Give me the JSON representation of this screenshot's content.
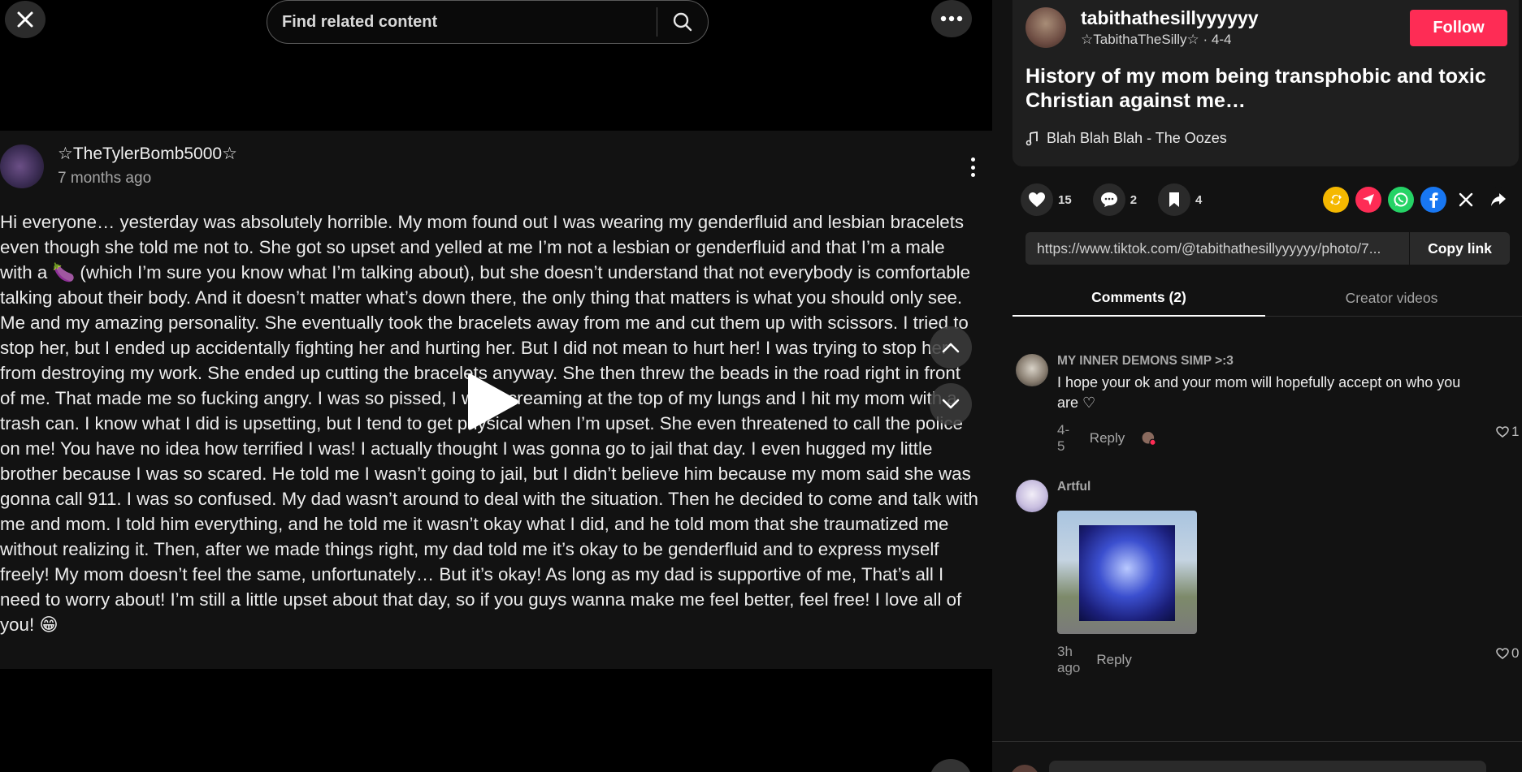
{
  "search": {
    "placeholder": "Find related content"
  },
  "post": {
    "author": "☆TheTylerBomb5000☆",
    "time": "7 months ago",
    "body": "Hi everyone… yesterday was absolutely horrible. My mom found out I was wearing my genderfluid and lesbian bracelets even though she told me not to. She got so upset and yelled at me I’m not a lesbian or genderfluid and that I’m a male with a 🍆 (which I’m sure you know what I’m talking about), but she doesn’t understand that not everybody is comfortable talking about their body. And it doesn’t matter what’s down there, the only thing that matters is what you should only see. Me and my amazing personality. She eventually took the bracelets away from me and cut them up with scissors. I tried to stop her, but I ended up accidentally fighting her and hurting her. But I did not mean to hurt her! I was trying to stop her from destroying my work. She ended up cutting the bracelets anyway. She then threw the beads in the road right in front of me. That made me so fucking angry. I was so pissed, I was screaming at the top of my lungs and I hit my mom with a trash can. I know what I did is upsetting, but I tend to get physical when I’m upset. She even threatened to call the police on me! You have no idea how terrified I was! I actually thought I was gonna go to jail that day. I even hugged my little brother because I was so scared. He told me I wasn’t going to jail, but I didn’t believe him because my mom said she was gonna call 911. I was so confused. My dad wasn’t around to deal with the situation. Then he decided to come and talk with me and mom. I told him everything, and he told me it wasn’t okay what I did, and he told mom that she traumatized me without realizing it. Then, after we made things right, my dad told me it’s okay to be genderfluid and to express myself freely! My mom doesn’t feel the same, unfortunately… But it’s okay! As long as my dad is supportive of me, That’s all I need to worry about! I’m still a little upset about that day, so if you guys wanna make me feel better, feel free! I love all of you! 😁"
  },
  "creator": {
    "username": "tabithathesillyyyyyy",
    "nickname_date": "☆TabithaTheSilly☆ · 4-4",
    "follow_label": "Follow"
  },
  "title": "History of my mom being transphobic and toxic Christian against me…",
  "music": "Blah Blah Blah - The Oozes",
  "stats": {
    "likes": "15",
    "comments": "2",
    "saves": "4"
  },
  "share_icons": [
    {
      "name": "repost-icon",
      "color": "#f5b800"
    },
    {
      "name": "send-icon",
      "color": "#fe2c55"
    },
    {
      "name": "whatsapp-icon",
      "color": "#25d366"
    },
    {
      "name": "facebook-icon",
      "color": "#1877f2"
    },
    {
      "name": "x-icon",
      "color": "#000000"
    },
    {
      "name": "share-arrow-icon",
      "color": "#ffffff"
    }
  ],
  "link": {
    "url": "https://www.tiktok.com/@tabithathesillyyyyyy/photo/7...",
    "copy_label": "Copy link"
  },
  "tabs": [
    {
      "label": "Comments (2)",
      "active": true
    },
    {
      "label": "Creator videos",
      "active": false
    }
  ],
  "comments": [
    {
      "user": "MY INNER DEMONS SIMP >:3",
      "text": "I hope your ok and your mom will hopefully accept on who you are ♡",
      "date": "4-5",
      "reply_label": "Reply",
      "likes": "1"
    },
    {
      "user": "Artful",
      "text": "",
      "date": "3h ago",
      "reply_label": "Reply",
      "likes": "0"
    }
  ]
}
